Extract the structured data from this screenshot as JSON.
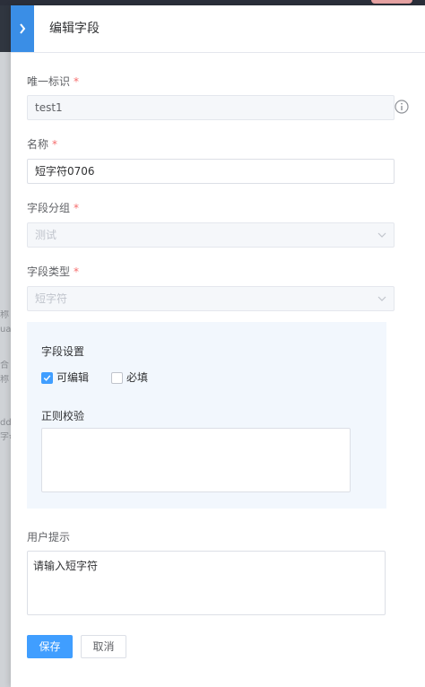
{
  "background": {
    "fragments": [
      "称",
      "ual",
      "合",
      "称",
      "dd",
      "字母"
    ]
  },
  "drawer": {
    "title": "编辑字段"
  },
  "form": {
    "id": {
      "label": "唯一标识",
      "required": "*",
      "value": "test1"
    },
    "name": {
      "label": "名称",
      "required": "*",
      "value": "短字符0706"
    },
    "group": {
      "label": "字段分组",
      "required": "*",
      "value": "测试"
    },
    "type": {
      "label": "字段类型",
      "required": "*",
      "value": "短字符"
    },
    "settings": {
      "title": "字段设置",
      "editable": {
        "label": "可编辑",
        "checked": true
      },
      "required_cb": {
        "label": "必填",
        "checked": false
      },
      "regex_label": "正则校验",
      "regex_value": ""
    },
    "hint": {
      "label": "用户提示",
      "value": "请输入短字符"
    }
  },
  "buttons": {
    "save": "保存",
    "cancel": "取消"
  },
  "colors": {
    "primary": "#409eff",
    "required": "#f56c6c",
    "settings_bg": "#f2f7fd",
    "collapse": "#3a8ee6"
  },
  "icons": {
    "collapse": "chevron-right-icon",
    "info": "info-circle-icon",
    "dropdown": "chevron-down-icon",
    "check": "check-icon"
  }
}
